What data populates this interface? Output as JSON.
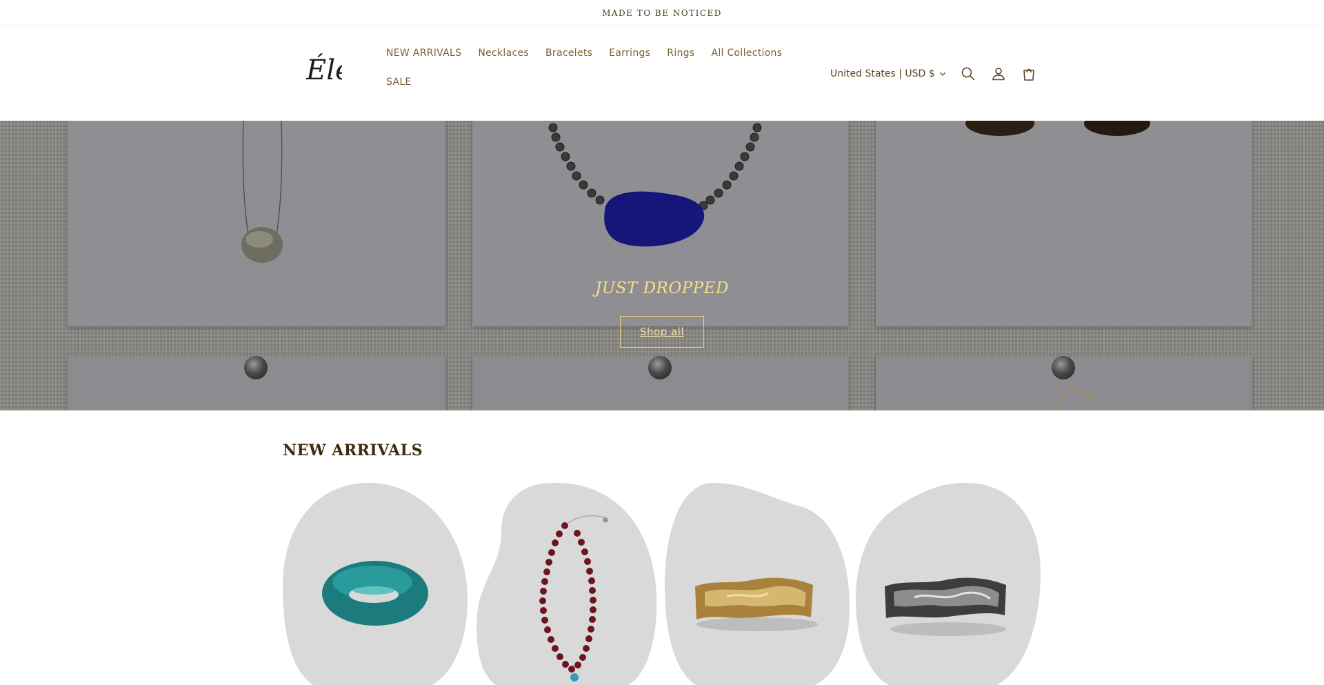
{
  "announcement": {
    "text": "MADE TO BE NOTICED"
  },
  "header": {
    "logo_text": "Éle",
    "nav": [
      {
        "label": "NEW ARRIVALS"
      },
      {
        "label": "Necklaces"
      },
      {
        "label": "Bracelets"
      },
      {
        "label": "Earrings"
      },
      {
        "label": "Rings"
      },
      {
        "label": "All Collections"
      },
      {
        "label": "SALE"
      }
    ],
    "country_selector": "United States | USD $",
    "icons": [
      "search-icon",
      "account-icon",
      "cart-icon"
    ]
  },
  "hero": {
    "title": "JUST DROPPED",
    "button_label": "Shop all"
  },
  "new_arrivals": {
    "title": "NEW ARRIVALS",
    "products": [
      {
        "image": "teal-bangle"
      },
      {
        "image": "beaded-necklace"
      },
      {
        "image": "gold-cuff"
      },
      {
        "image": "silver-cuff"
      }
    ]
  },
  "colors": {
    "accent_text": "#7a6130",
    "hero_title": "#f2e08c",
    "blob_bg": "#d9d9d9"
  }
}
